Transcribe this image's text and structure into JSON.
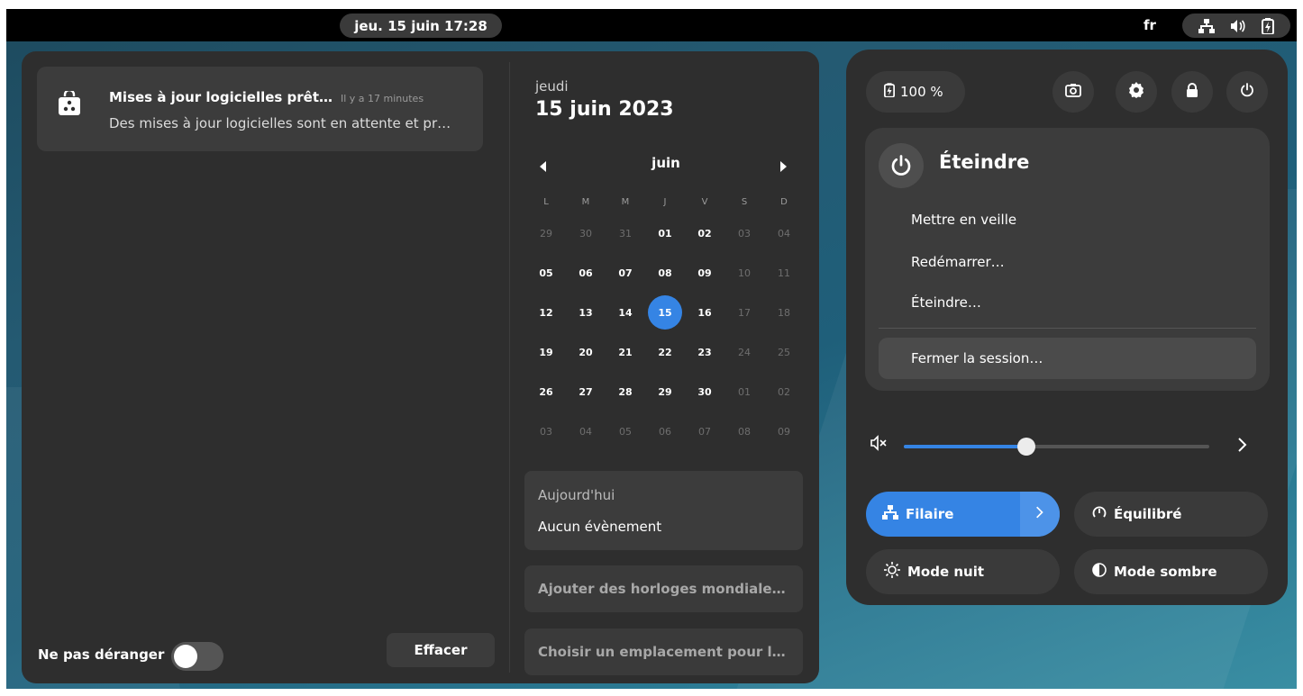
{
  "topbar": {
    "datetime": "jeu. 15 juin  17:28",
    "language": "fr"
  },
  "notification": {
    "title": "Mises à jour logicielles prêt…",
    "time": "Il y a 17 minutes",
    "body": "Des mises à jour logicielles sont en attente et pr…",
    "icon": "software-update-icon"
  },
  "dnd": {
    "label": "Ne pas déranger",
    "enabled": false
  },
  "clear_label": "Effacer",
  "calendar": {
    "day_name": "jeudi",
    "full_date": "15 juin 2023",
    "month": "juin",
    "weekdays": [
      "L",
      "M",
      "M",
      "J",
      "V",
      "S",
      "D"
    ],
    "weeks": [
      [
        "29",
        "30",
        "31",
        "01",
        "02",
        "03",
        "04"
      ],
      [
        "05",
        "06",
        "07",
        "08",
        "09",
        "10",
        "11"
      ],
      [
        "12",
        "13",
        "14",
        "15",
        "16",
        "17",
        "18"
      ],
      [
        "19",
        "20",
        "21",
        "22",
        "23",
        "24",
        "25"
      ],
      [
        "26",
        "27",
        "28",
        "29",
        "30",
        "01",
        "02"
      ],
      [
        "03",
        "04",
        "05",
        "06",
        "07",
        "08",
        "09"
      ]
    ],
    "today": "15"
  },
  "events": {
    "header": "Aujourd'hui",
    "empty": "Aucun évènement"
  },
  "world_clocks": "Ajouter des horloges mondiale…",
  "weather": "Choisir un emplacement pour l…",
  "quick_settings": {
    "battery": "100 %",
    "power_menu": {
      "title": "Éteindre",
      "items": [
        "Mettre en veille",
        "Redémarrer…",
        "Éteindre…"
      ],
      "logout": "Fermer la session…"
    },
    "volume_level": 0.4,
    "tiles": {
      "wired": "Filaire",
      "power_profile": "Équilibré",
      "night_mode": "Mode nuit",
      "dark_mode": "Mode sombre"
    },
    "accent_color": "#3584e4"
  }
}
